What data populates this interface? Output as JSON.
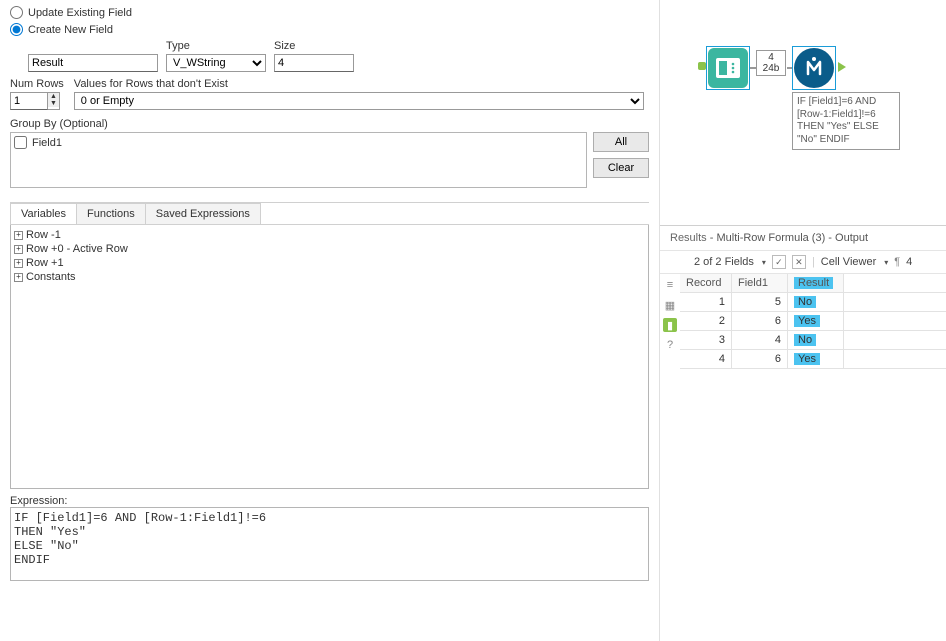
{
  "config": {
    "radio_update": "Update Existing Field",
    "radio_create": "Create New  Field",
    "field_name_value": "Result",
    "type_label": "Type",
    "type_value": "V_WString",
    "size_label": "Size",
    "size_value": "4",
    "numrows_label": "Num Rows",
    "numrows_value": "1",
    "values_label": "Values for Rows that don't Exist",
    "values_value": "0 or Empty",
    "groupby_label": "Group By (Optional)",
    "groupby_items": [
      "Field1"
    ],
    "btn_all": "All",
    "btn_clear": "Clear"
  },
  "vars": {
    "tabs": [
      "Variables",
      "Functions",
      "Saved Expressions"
    ],
    "tree": [
      "Row -1",
      "Row +0 - Active Row",
      "Row +1",
      "Constants"
    ]
  },
  "expression": {
    "label": "Expression:",
    "text": "IF [Field1]=6 AND [Row-1:Field1]!=6\nTHEN \"Yes\"\nELSE \"No\"\nENDIF"
  },
  "canvas": {
    "label1": "4",
    "label2": "24b",
    "annotation": "IF [Field1]=6 AND\n[Row-1:Field1]!=6\nTHEN \"Yes\"\nELSE \"No\"\nENDIF"
  },
  "results": {
    "title_prefix": "Results",
    "title_suffix": " - Multi-Row Formula (3) - Output",
    "fields_text": "2 of 2 Fields",
    "cell_viewer": "Cell Viewer",
    "count4": "4",
    "headers": [
      "Record",
      "Field1",
      "Result"
    ],
    "rows": [
      {
        "rec": "1",
        "f1": "5",
        "res": "No"
      },
      {
        "rec": "2",
        "f1": "6",
        "res": "Yes"
      },
      {
        "rec": "3",
        "f1": "4",
        "res": "No"
      },
      {
        "rec": "4",
        "f1": "6",
        "res": "Yes"
      }
    ]
  }
}
